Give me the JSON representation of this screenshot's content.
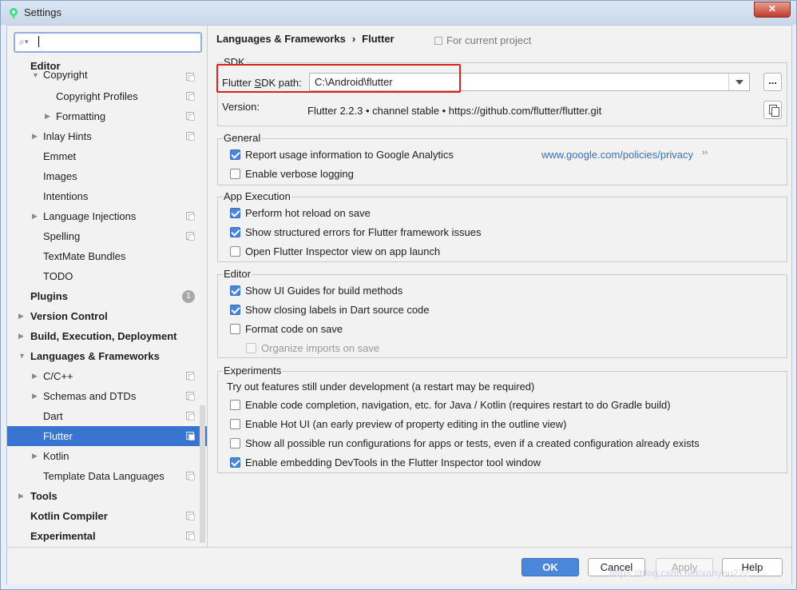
{
  "window": {
    "title": "Settings",
    "close_label": "✕"
  },
  "search": {
    "placeholder": "",
    "value": ""
  },
  "sidebar": {
    "items": [
      {
        "label": "Editor",
        "bold": true
      },
      {
        "label": "Copyright"
      },
      {
        "label": "Copyright Profiles"
      },
      {
        "label": "Formatting"
      },
      {
        "label": "Inlay Hints"
      },
      {
        "label": "Emmet"
      },
      {
        "label": "Images"
      },
      {
        "label": "Intentions"
      },
      {
        "label": "Language Injections"
      },
      {
        "label": "Spelling"
      },
      {
        "label": "TextMate Bundles"
      },
      {
        "label": "TODO"
      },
      {
        "label": "Plugins",
        "badge": "1"
      },
      {
        "label": "Version Control"
      },
      {
        "label": "Build, Execution, Deployment"
      },
      {
        "label": "Languages & Frameworks"
      },
      {
        "label": "C/C++"
      },
      {
        "label": "Schemas and DTDs"
      },
      {
        "label": "Dart"
      },
      {
        "label": "Flutter",
        "selected": true
      },
      {
        "label": "Kotlin"
      },
      {
        "label": "Template Data Languages"
      },
      {
        "label": "Tools"
      },
      {
        "label": "Kotlin Compiler"
      },
      {
        "label": "Experimental"
      }
    ]
  },
  "header": {
    "breadcrumb_parent": "Languages & Frameworks",
    "breadcrumb_sep": "›",
    "breadcrumb_current": "Flutter",
    "scope": "For current project"
  },
  "sdk": {
    "group_title": "SDK",
    "path_label": "Flutter SDK path:",
    "path_value": "C:\\Android\\flutter",
    "browse_label": "...",
    "version_label": "Version:",
    "version_value": "Flutter 2.2.3 • channel stable • https://github.com/flutter/flutter.git"
  },
  "general": {
    "group_title": "General",
    "items": [
      {
        "label": "Report usage information to Google Analytics",
        "checked": true
      },
      {
        "label": "Enable verbose logging",
        "checked": false
      }
    ],
    "privacy_link": "www.google.com/policies/privacy",
    "privacy_arrow": "››"
  },
  "app_execution": {
    "group_title": "App Execution",
    "items": [
      {
        "label": "Perform hot reload on save",
        "checked": true
      },
      {
        "label": "Show structured errors for Flutter framework issues",
        "checked": true
      },
      {
        "label": "Open Flutter Inspector view on app launch",
        "checked": false
      }
    ]
  },
  "editor": {
    "group_title": "Editor",
    "items": [
      {
        "label": "Show UI Guides for build methods",
        "checked": true
      },
      {
        "label": "Show closing labels in Dart source code",
        "checked": true
      },
      {
        "label": "Format code on save",
        "checked": false
      },
      {
        "label": "Organize imports on save",
        "checked": false,
        "disabled": true
      }
    ]
  },
  "experiments": {
    "group_title": "Experiments",
    "description": "Try out features still under development (a restart may be required)",
    "items": [
      {
        "label": "Enable code completion, navigation, etc. for Java / Kotlin (requires restart to do Gradle build)",
        "checked": false
      },
      {
        "label": "Enable Hot UI (an early preview of property editing in the outline view)",
        "checked": false
      },
      {
        "label": "Show all possible run configurations for apps or tests, even if a created configuration already exists",
        "checked": false
      },
      {
        "label": "Enable embedding DevTools in the Flutter Inspector tool window",
        "checked": true
      }
    ]
  },
  "footer": {
    "ok": "OK",
    "cancel": "Cancel",
    "apply": "Apply",
    "help": "Help"
  },
  "watermark": "https://blog.csdn.net/xanyou222",
  "colors": {
    "selection": "#3874d0",
    "primary_button": "#4a86d9",
    "highlight_box": "#e0201a",
    "link": "#3a6fb8"
  }
}
